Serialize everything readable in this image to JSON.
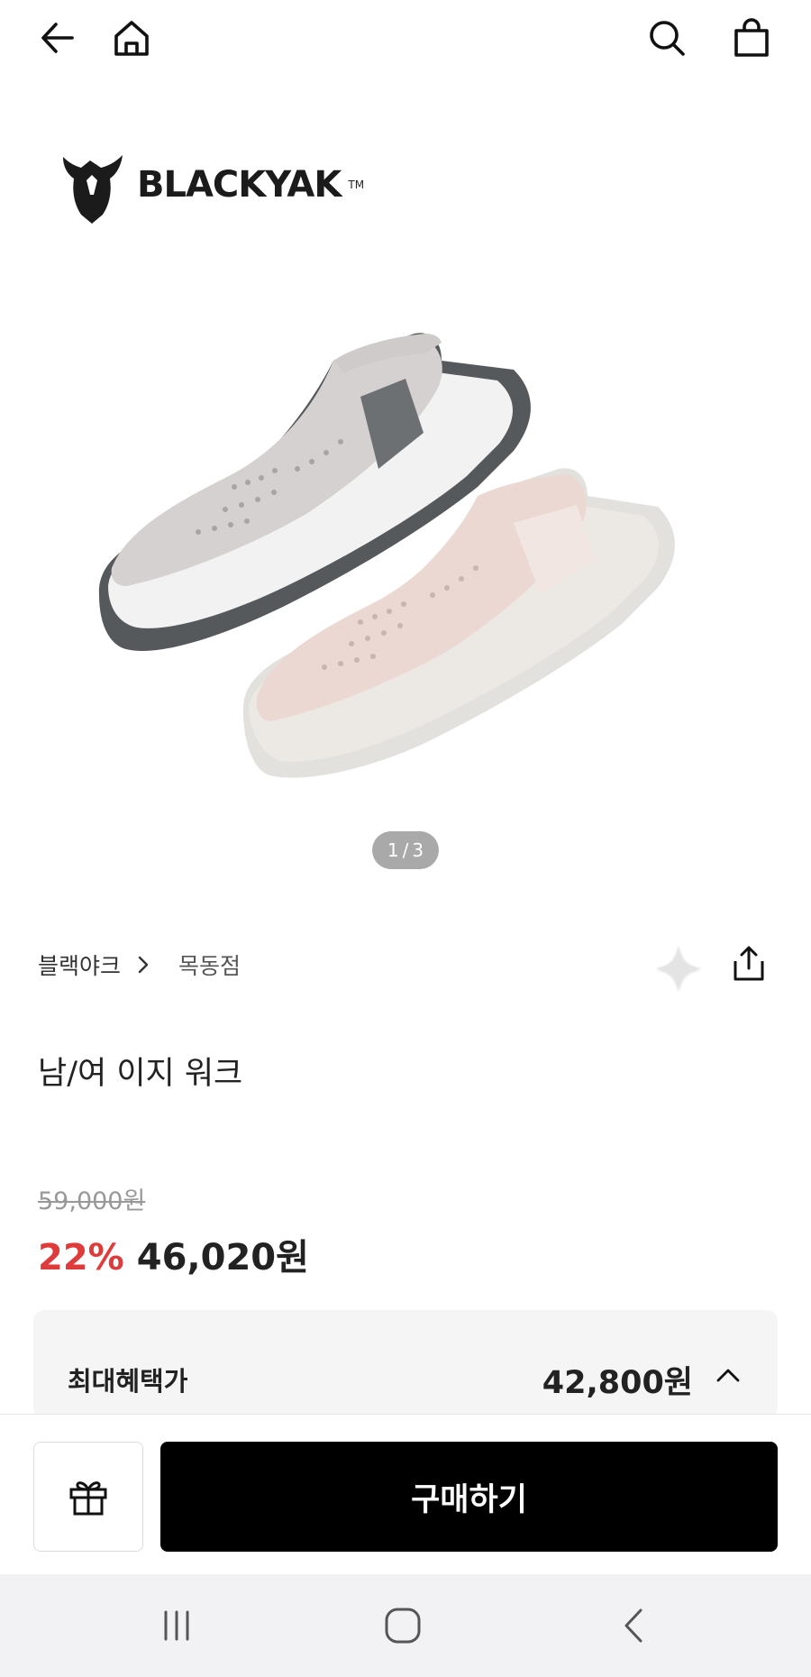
{
  "topbar": {
    "back_icon": "arrow-left-icon",
    "home_icon": "home-icon",
    "search_icon": "search-icon",
    "cart_icon": "shopping-bag-icon"
  },
  "hero": {
    "brand_logo_text": "BLACKYAK",
    "pager": {
      "current": "1",
      "separator": "/",
      "total": "3"
    }
  },
  "product": {
    "brand": "블랙야크",
    "store": "목동점",
    "title": "남/여 이지 워크",
    "original_price": "59,000원",
    "discount": "22%",
    "sale_price": "46,020원"
  },
  "benefit": {
    "label": "최대혜택가",
    "value": "42,800원"
  },
  "actions": {
    "gift_icon": "gift-icon",
    "buy_label": "구매하기"
  },
  "colors": {
    "discount_red": "#e03b3b",
    "buy_button_bg": "#000000",
    "benefit_bg": "#f5f5f6"
  }
}
